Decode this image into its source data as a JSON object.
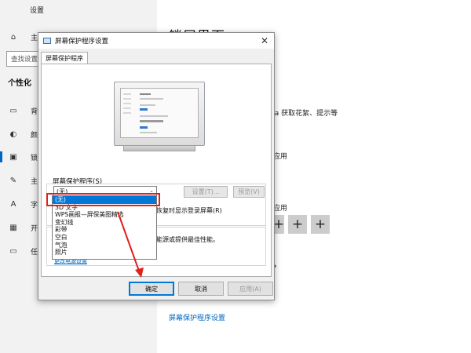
{
  "window": {
    "title": "设置"
  },
  "sidebar": {
    "home": "主页",
    "search_placeholder": "查找设置",
    "section": "个性化",
    "items": [
      {
        "label": "背景",
        "icon": "image-icon"
      },
      {
        "label": "颜色",
        "icon": "palette-icon"
      },
      {
        "label": "锁屏界面",
        "icon": "lock-screen-icon"
      },
      {
        "label": "主题",
        "icon": "brush-icon"
      },
      {
        "label": "字体",
        "icon": "font-icon"
      },
      {
        "label": "开始",
        "icon": "start-icon"
      },
      {
        "label": "任务栏",
        "icon": "taskbar-icon"
      }
    ]
  },
  "main": {
    "heading": "锁屏界面",
    "spotlight_text": "na 获取花絮、提示等",
    "apply_text_1": "应用",
    "apply_text_2": "应用",
    "screensaver_link": "屏幕保护程序设置"
  },
  "dialog": {
    "title": "屏幕保护程序设置",
    "tab": "屏幕保护程序",
    "group_label": "屏幕保护程序(S)",
    "selected_value": "(无)",
    "settings_button": "设置(T)...",
    "preview_button": "预览(V)",
    "login_text": "恢复时显示登录屏幕(R)",
    "power_text": "能源或提供最佳性能。",
    "power_link": "更改电源设置",
    "dropdown_options": [
      "(无)",
      "3D 文字",
      "WPS画报—屏保美图精选",
      "变幻线",
      "彩带",
      "空白",
      "气泡",
      "照片"
    ],
    "ok_button": "确定",
    "cancel_button": "取消",
    "apply_button": "应用(A)"
  },
  "colors": {
    "accent": "#0078d7",
    "highlight_red": "#e0201b"
  }
}
